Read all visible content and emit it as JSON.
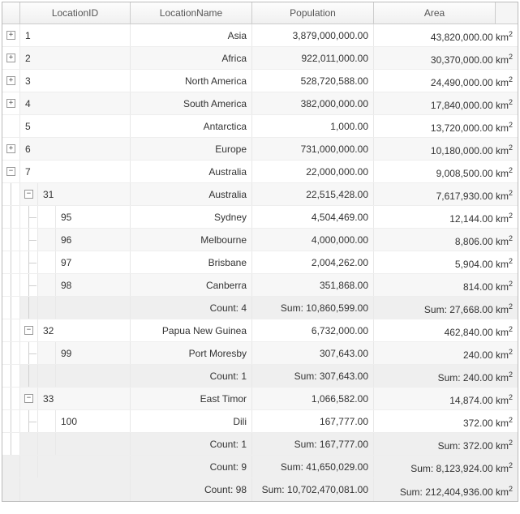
{
  "headers": {
    "id": "LocationID",
    "name": "LocationName",
    "pop": "Population",
    "area": "Area"
  },
  "rows": {
    "r1": {
      "id": "1",
      "name": "Asia",
      "pop": "3,879,000,000.00",
      "area": "43,820,000.00"
    },
    "r2": {
      "id": "2",
      "name": "Africa",
      "pop": "922,011,000.00",
      "area": "30,370,000.00"
    },
    "r3": {
      "id": "3",
      "name": "North America",
      "pop": "528,720,588.00",
      "area": "24,490,000.00"
    },
    "r4": {
      "id": "4",
      "name": "South America",
      "pop": "382,000,000.00",
      "area": "17,840,000.00"
    },
    "r5": {
      "id": "5",
      "name": "Antarctica",
      "pop": "1,000.00",
      "area": "13,720,000.00"
    },
    "r6": {
      "id": "6",
      "name": "Europe",
      "pop": "731,000,000.00",
      "area": "10,180,000.00"
    },
    "r7": {
      "id": "7",
      "name": "Australia",
      "pop": "22,000,000.00",
      "area": "9,008,500.00"
    },
    "r31": {
      "id": "31",
      "name": "Australia",
      "pop": "22,515,428.00",
      "area": "7,617,930.00"
    },
    "r95": {
      "id": "95",
      "name": "Sydney",
      "pop": "4,504,469.00",
      "area": "12,144.00"
    },
    "r96": {
      "id": "96",
      "name": "Melbourne",
      "pop": "4,000,000.00",
      "area": "8,806.00"
    },
    "r97": {
      "id": "97",
      "name": "Brisbane",
      "pop": "2,004,262.00",
      "area": "5,904.00"
    },
    "r98": {
      "id": "98",
      "name": "Canberra",
      "pop": "351,868.00",
      "area": "814.00"
    },
    "r32": {
      "id": "32",
      "name": "Papua New Guinea",
      "pop": "6,732,000.00",
      "area": "462,840.00"
    },
    "r99": {
      "id": "99",
      "name": "Port Moresby",
      "pop": "307,643.00",
      "area": "240.00"
    },
    "r33": {
      "id": "33",
      "name": "East Timor",
      "pop": "1,066,582.00",
      "area": "14,874.00"
    },
    "r100": {
      "id": "100",
      "name": "Dili",
      "pop": "167,777.00",
      "area": "372.00"
    }
  },
  "sums": {
    "s31": {
      "count": "Count: 4",
      "sum": "Sum: 10,860,599.00",
      "area": "Sum: 27,668.00"
    },
    "s32": {
      "count": "Count: 1",
      "sum": "Sum: 307,643.00",
      "area": "Sum: 240.00"
    },
    "s33": {
      "count": "Count: 1",
      "sum": "Sum: 167,777.00",
      "area": "Sum: 372.00"
    },
    "s7": {
      "count": "Count: 9",
      "sum": "Sum: 41,650,029.00",
      "area": "Sum: 8,123,924.00"
    },
    "sTotal": {
      "count": "Count: 98",
      "sum": "Sum: 10,702,470,081.00",
      "area": "Sum: 212,404,936.00"
    }
  },
  "unit": "km"
}
